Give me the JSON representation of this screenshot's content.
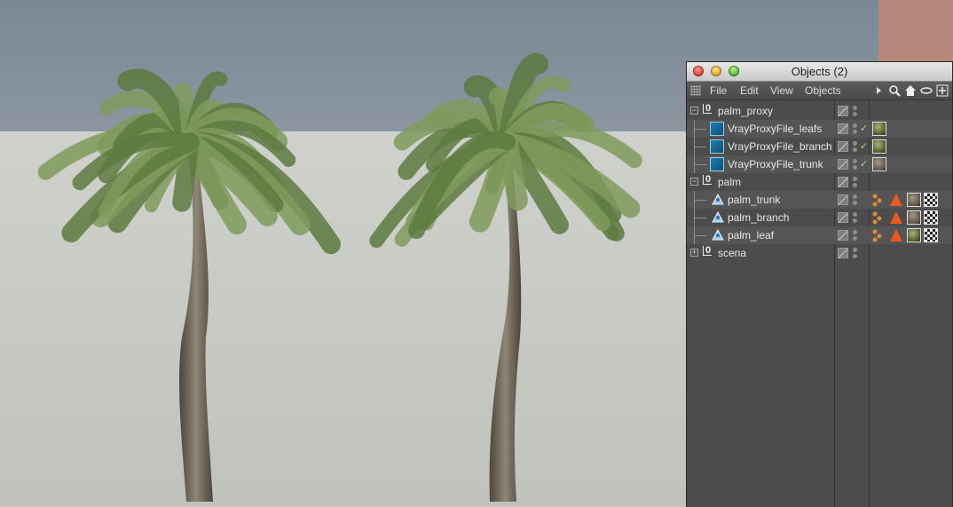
{
  "window": {
    "title": "Objects (2)",
    "menus": [
      "File",
      "Edit",
      "View",
      "Objects"
    ]
  },
  "tree": [
    {
      "name": "palm_proxy",
      "type": "null",
      "indent": 0,
      "fold": "−"
    },
    {
      "name": "VrayProxyFile_leafs",
      "type": "proxy",
      "indent": 1,
      "checked": true,
      "tag": "sphere-green"
    },
    {
      "name": "VrayProxyFile_branch",
      "type": "proxy",
      "indent": 1,
      "checked": true,
      "tag": "sphere-green"
    },
    {
      "name": "VrayProxyFile_trunk",
      "type": "proxy",
      "indent": 1,
      "checked": true,
      "tag": "sphere-brown"
    },
    {
      "name": "palm",
      "type": "null",
      "indent": 0,
      "fold": "−"
    },
    {
      "name": "palm_trunk",
      "type": "mesh",
      "indent": 1,
      "tags": [
        "sphere-brown",
        "checker"
      ]
    },
    {
      "name": "palm_branch",
      "type": "mesh",
      "indent": 1,
      "tags": [
        "sphere-brown",
        "checker"
      ]
    },
    {
      "name": "palm_leaf",
      "type": "mesh",
      "indent": 1,
      "tags": [
        "sphere-green",
        "checker"
      ]
    },
    {
      "name": "scena",
      "type": "null",
      "indent": 0,
      "fold": "+"
    }
  ],
  "colors": {
    "sky": "#7d8c99",
    "ground": "#c5c7c2",
    "panel": "#4c4c4c",
    "foliage": "#6f8a4e",
    "trunk": "#6b6455"
  }
}
